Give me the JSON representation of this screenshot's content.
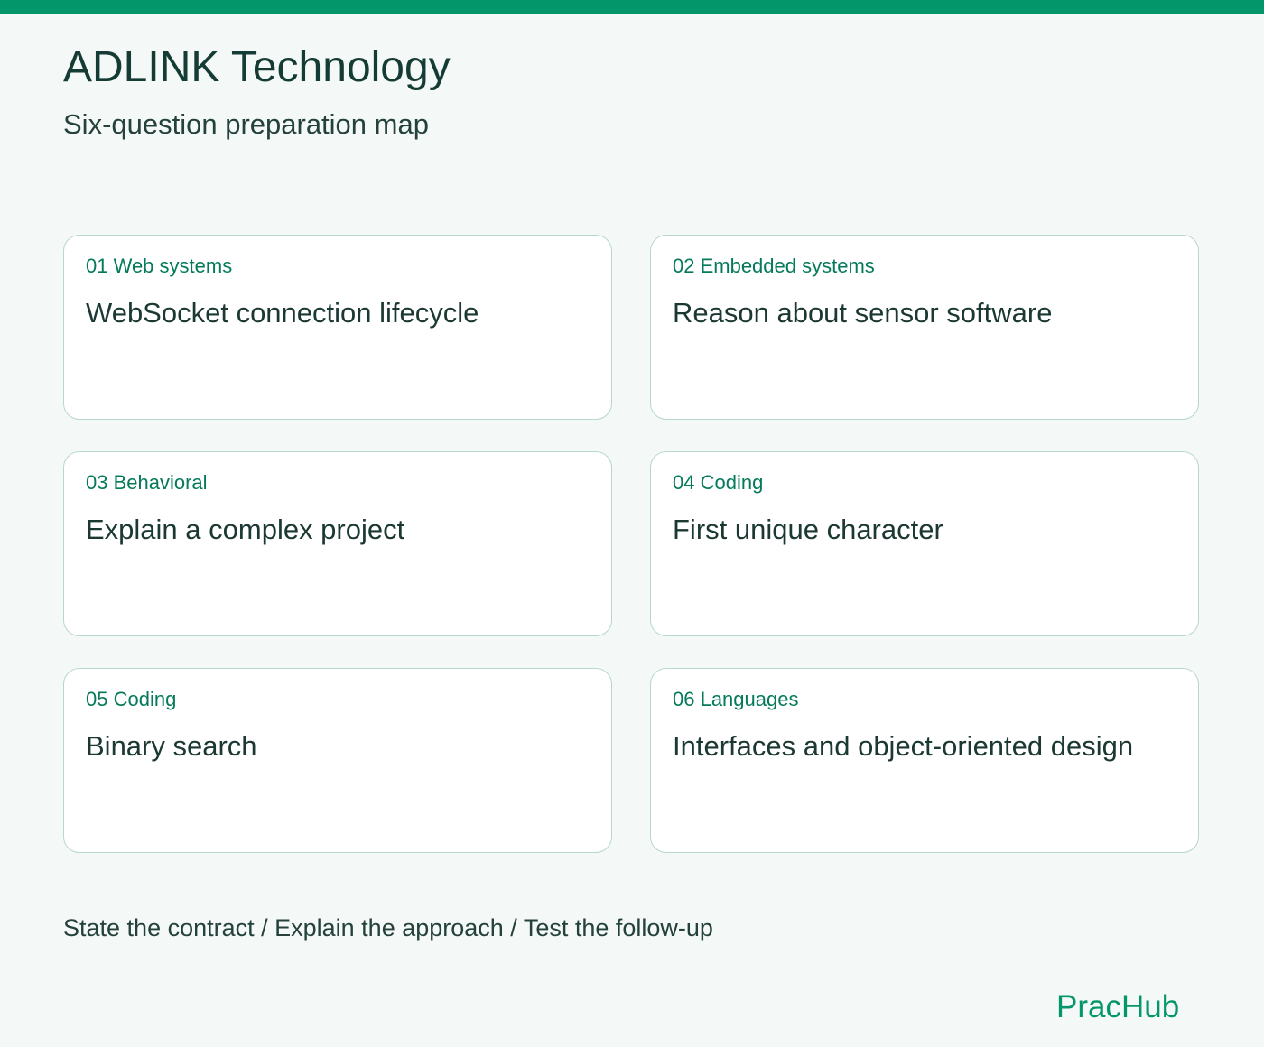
{
  "header": {
    "title": "ADLINK Technology",
    "subtitle": "Six-question preparation map"
  },
  "cards": [
    {
      "label": "01 Web systems",
      "title": "WebSocket connection lifecycle"
    },
    {
      "label": "02 Embedded systems",
      "title": "Reason about sensor software"
    },
    {
      "label": "03 Behavioral",
      "title": "Explain a complex project"
    },
    {
      "label": "04 Coding",
      "title": "First unique character"
    },
    {
      "label": "05 Coding",
      "title": "Binary search"
    },
    {
      "label": "06 Languages",
      "title": "Interfaces and object-oriented design"
    }
  ],
  "footer": {
    "steps": "State the contract / Explain the approach / Test the follow-up",
    "brand": "PracHub"
  },
  "colors": {
    "accent": "#04966b",
    "background": "#f4f8f6",
    "card_border": "#b7d7cd",
    "label_text": "#057a5a"
  }
}
